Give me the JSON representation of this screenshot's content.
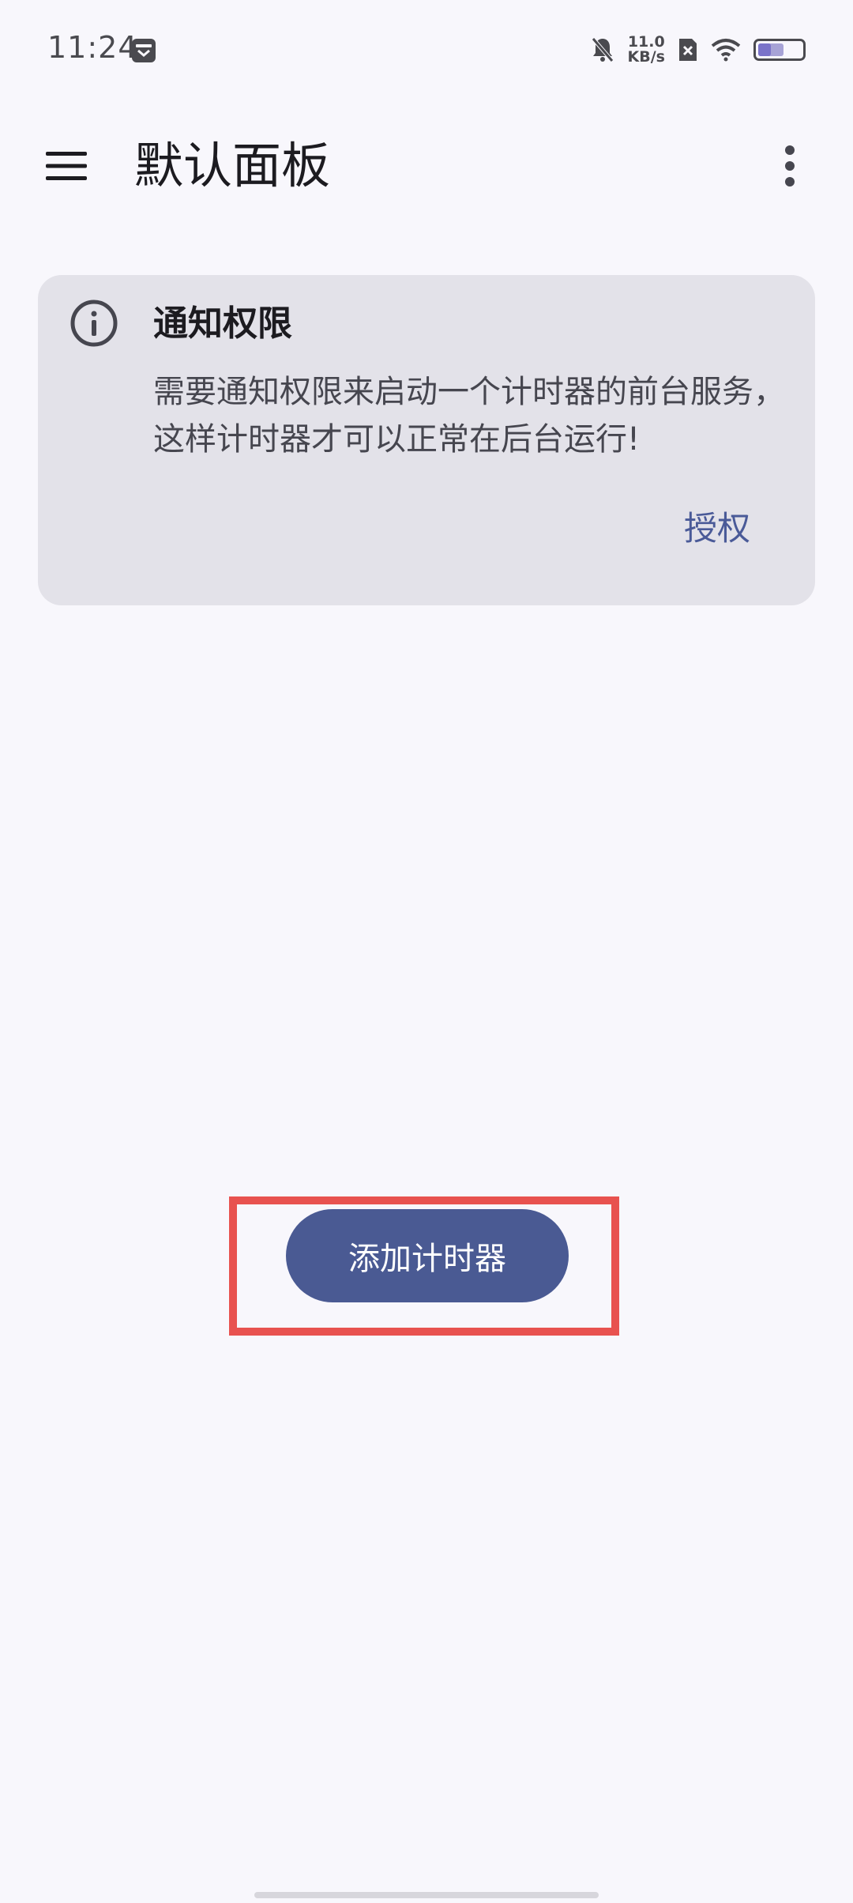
{
  "status_bar": {
    "time": "11:24",
    "net_speed_value": "11.0",
    "net_speed_unit": "KB/s",
    "battery_level": 0.6,
    "icons": [
      "calendar-notification-icon",
      "mute-bell-icon",
      "no-sim-icon",
      "wifi-icon",
      "battery-icon"
    ]
  },
  "app_bar": {
    "title": "默认面板",
    "menu_icon": "hamburger-menu-icon",
    "more_icon": "more-vertical-icon"
  },
  "banner": {
    "icon": "info-icon",
    "title": "通知权限",
    "message": "需要通知权限来启动一个计时器的前台服务，这样计时器才可以正常在后台运行!",
    "action_label": "授权"
  },
  "main": {
    "add_button_label": "添加计时器"
  },
  "colors": {
    "background": "#f8f7fc",
    "banner_bg": "#e3e2e9",
    "primary": "#4a5a93",
    "highlight": "#e8524f"
  }
}
